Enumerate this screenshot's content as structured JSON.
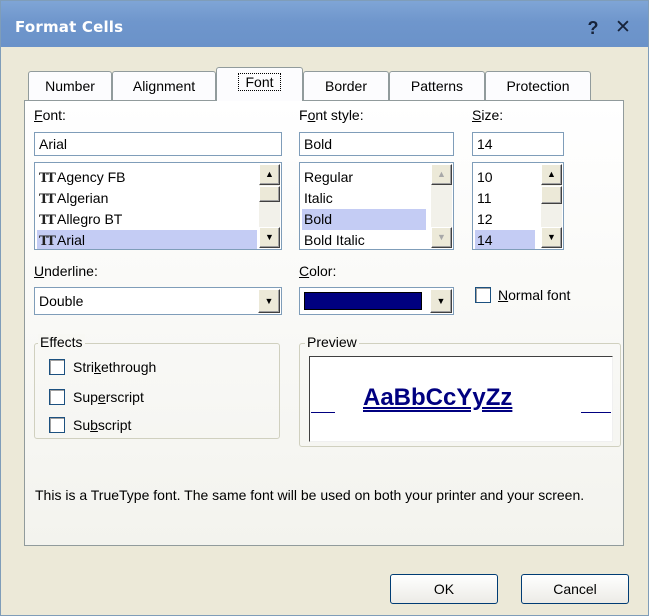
{
  "window": {
    "title": "Format Cells",
    "help_glyph": "?",
    "close_glyph": "✕"
  },
  "tabs": [
    {
      "label": "Number",
      "active": false
    },
    {
      "label": "Alignment",
      "active": false
    },
    {
      "label": "Font",
      "active": true
    },
    {
      "label": "Border",
      "active": false
    },
    {
      "label": "Patterns",
      "active": false
    },
    {
      "label": "Protection",
      "active": false
    }
  ],
  "font": {
    "label": "Font:",
    "value": "Arial",
    "items": [
      "Agency FB",
      "Algerian",
      "Allegro BT",
      "Arial"
    ],
    "selected": "Arial",
    "item_icon": "truetype-icon"
  },
  "font_style": {
    "label": "Font style:",
    "value": "Bold",
    "items": [
      "Regular",
      "Italic",
      "Bold",
      "Bold Italic"
    ],
    "selected": "Bold"
  },
  "size": {
    "label": "Size:",
    "value": "14",
    "items": [
      "10",
      "11",
      "12",
      "14"
    ],
    "selected": "14"
  },
  "underline": {
    "label": "Underline:",
    "value": "Double"
  },
  "color": {
    "label": "Color:",
    "value": "#000080"
  },
  "normal_font": {
    "label": "Normal font",
    "checked": false
  },
  "effects": {
    "label": "Effects",
    "items": [
      {
        "label": "Strikethrough",
        "checked": false
      },
      {
        "label": "Superscript",
        "checked": false
      },
      {
        "label": "Subscript",
        "checked": false
      }
    ]
  },
  "preview": {
    "label": "Preview",
    "sample": "AaBbCcYyZz",
    "color": "#000080"
  },
  "info_text": "This is a TrueType font.  The same font will be used on both your printer and your screen.",
  "buttons": {
    "ok": "OK",
    "cancel": "Cancel"
  }
}
